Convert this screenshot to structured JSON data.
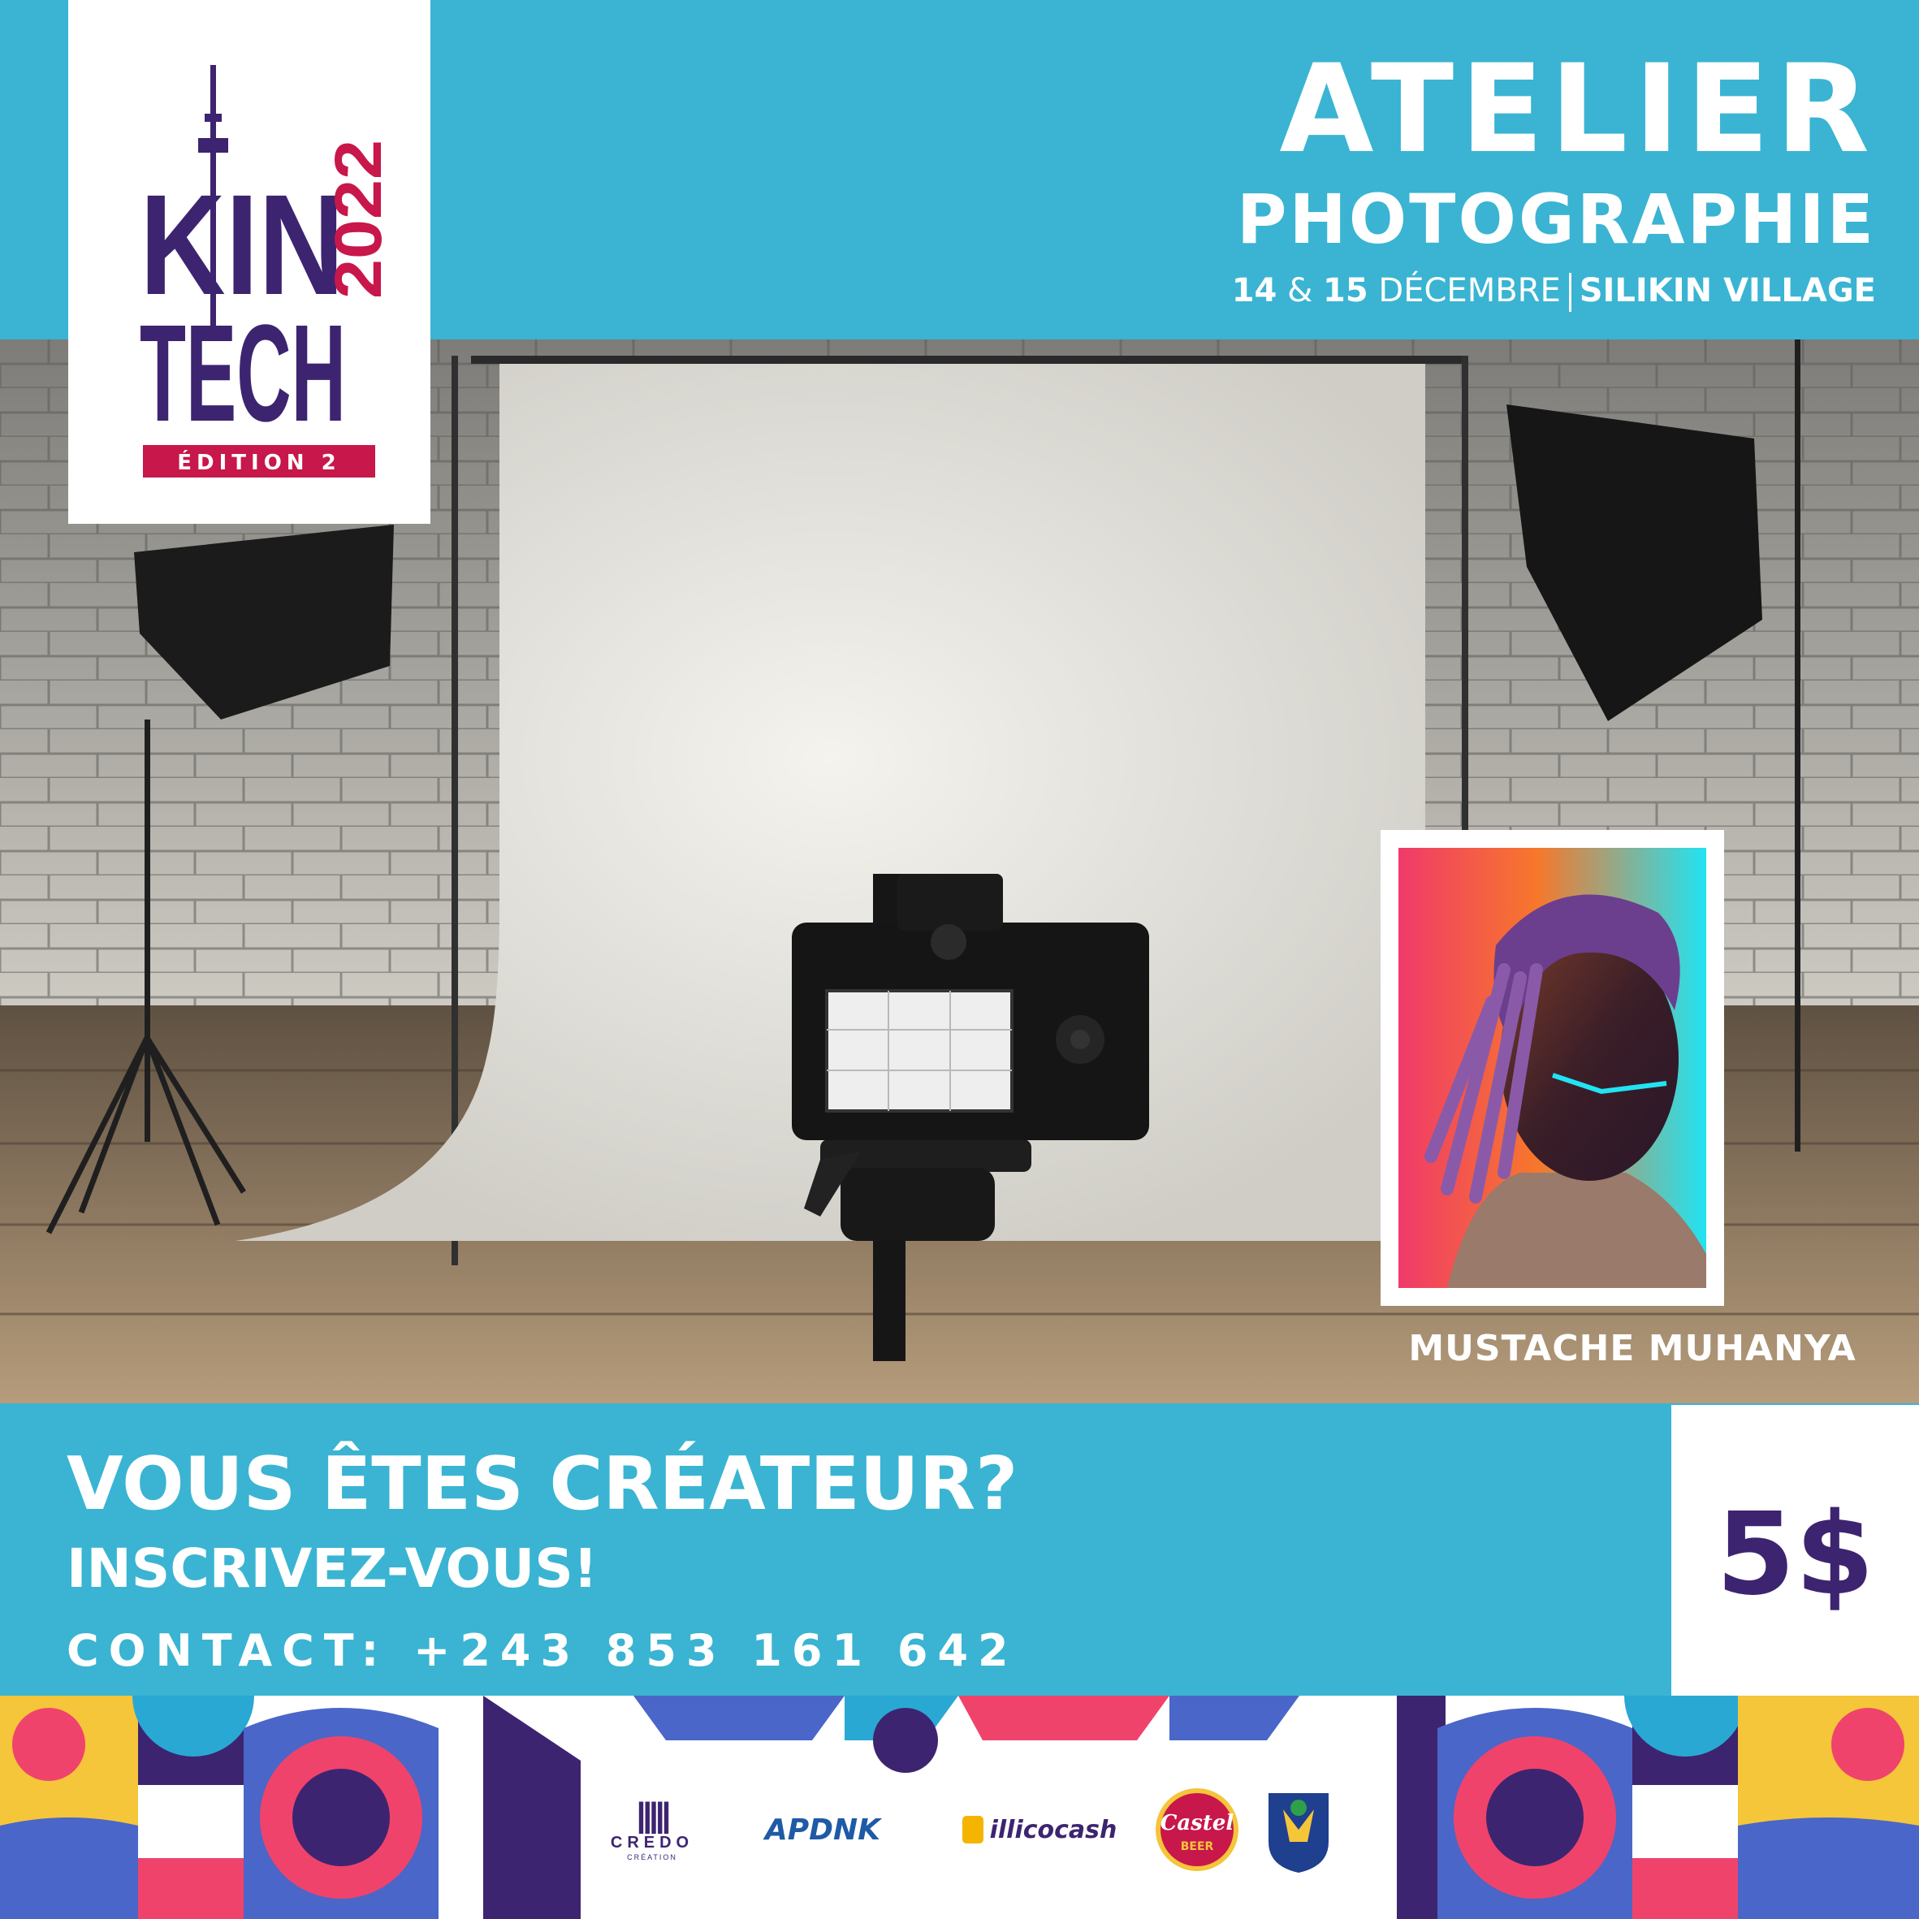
{
  "logo": {
    "kin": "KIN",
    "tech": "TECH",
    "year": "2022",
    "edition": "ÉDITION 2"
  },
  "event": {
    "title": "ATELIER",
    "subtitle": "PHOTOGRAPHIE",
    "date_days": "14",
    "date_amp": "&",
    "date_day2": "15",
    "date_month": "DÉCEMBRE",
    "venue": "SILIKIN VILLAGE"
  },
  "speaker": {
    "name": "MUSTACHE MUHANYA"
  },
  "cta": {
    "headline": "VOUS ÊTES CRÉATEUR?",
    "sub": "INSCRIVEZ-VOUS!",
    "contact": "CONTACT: +243 853 161 642"
  },
  "price": "5$",
  "sponsors": {
    "credo_line1": "CREDO",
    "credo_line2": "CRÉATION",
    "apdnk": "APDNK",
    "illicocash": "illicocash",
    "castel_line1": "Castel",
    "castel_line2": "BEER"
  },
  "colors": {
    "brand_blue": "#3ab4d2",
    "brand_purple": "#3d2470",
    "brand_red": "#c8174a",
    "white": "#ffffff"
  }
}
